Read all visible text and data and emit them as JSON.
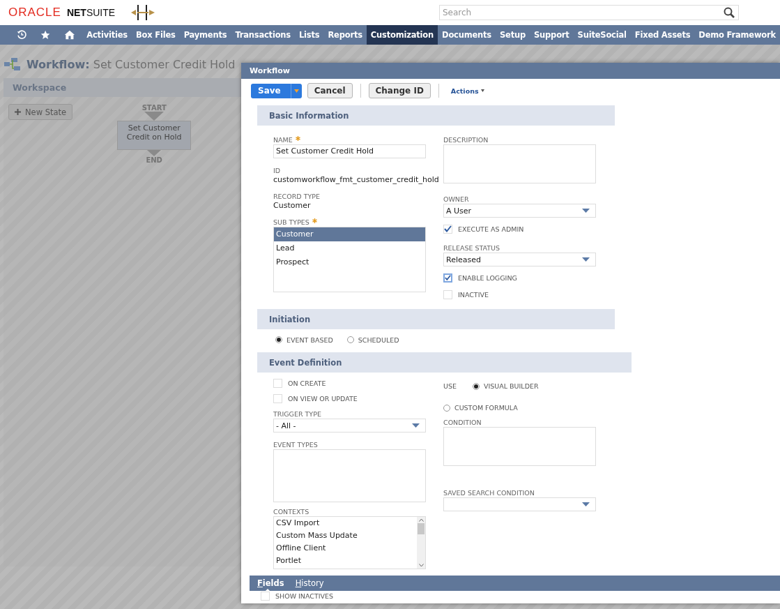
{
  "brand": {
    "oracle": "ORACLE",
    "netsuite": "**NET**SUITE"
  },
  "search": {
    "placeholder": "Search"
  },
  "nav": [
    {
      "label": "Activities",
      "selected": false
    },
    {
      "label": "Box Files",
      "selected": false
    },
    {
      "label": "Payments",
      "selected": false
    },
    {
      "label": "Transactions",
      "selected": false
    },
    {
      "label": "Lists",
      "selected": false
    },
    {
      "label": "Reports",
      "selected": false
    },
    {
      "label": "Customization",
      "selected": true
    },
    {
      "label": "Documents",
      "selected": false
    },
    {
      "label": "Setup",
      "selected": false
    },
    {
      "label": "Support",
      "selected": false
    },
    {
      "label": "SuiteSocial",
      "selected": false
    },
    {
      "label": "Fixed Assets",
      "selected": false
    },
    {
      "label": "Demo Framework",
      "selected": false
    }
  ],
  "page_title": {
    "label": "Workflow:",
    "value": "Set Customer Credit Hold"
  },
  "workspace": {
    "title": "Workspace",
    "new_state": "New State",
    "start": "START",
    "state": "Set Customer Credit on Hold",
    "end": "END"
  },
  "dialog": {
    "title": "Workflow",
    "save": "Save",
    "cancel": "Cancel",
    "change_id": "Change ID",
    "actions": "Actions"
  },
  "basic_information": {
    "title": "Basic Information",
    "name": {
      "label": "NAME",
      "required": true,
      "value": "Set Customer Credit Hold"
    },
    "id": {
      "label": "ID",
      "value": "customworkflow_fmt_customer_credit_hold"
    },
    "record_type": {
      "label": "RECORD TYPE",
      "value": "Customer"
    },
    "sub_types": {
      "label": "SUB TYPES",
      "required": true,
      "options": [
        {
          "label": "Customer",
          "selected": true
        },
        {
          "label": "Lead",
          "selected": false
        },
        {
          "label": "Prospect",
          "selected": false
        }
      ]
    },
    "description": {
      "label": "DESCRIPTION"
    },
    "owner": {
      "label": "OWNER",
      "value": "A User"
    },
    "execute_as_admin": {
      "label": "EXECUTE AS ADMIN",
      "checked": true
    },
    "release_status": {
      "label": "RELEASE STATUS",
      "value": "Released"
    },
    "enable_logging": {
      "label": "ENABLE LOGGING",
      "checked": true,
      "focused": true
    },
    "inactive": {
      "label": "INACTIVE",
      "checked": false
    }
  },
  "initiation": {
    "title": "Initiation",
    "options": [
      {
        "label": "EVENT BASED",
        "selected": true
      },
      {
        "label": "SCHEDULED",
        "selected": false
      }
    ]
  },
  "event_definition": {
    "title": "Event Definition",
    "on_create": {
      "label": "ON CREATE",
      "checked": false
    },
    "on_view_or_update": {
      "label": "ON VIEW OR UPDATE",
      "checked": false
    },
    "trigger_type": {
      "label": "TRIGGER TYPE",
      "value": "- All -"
    },
    "event_types": {
      "label": "EVENT TYPES"
    },
    "contexts": {
      "label": "CONTEXTS",
      "options": [
        {
          "label": "CSV Import",
          "selected": false
        },
        {
          "label": "Custom Mass Update",
          "selected": false
        },
        {
          "label": "Offline Client",
          "selected": false
        },
        {
          "label": "Portlet",
          "selected": false
        }
      ]
    },
    "use": {
      "label": "USE",
      "options": [
        {
          "label": "VISUAL BUILDER",
          "selected": true
        },
        {
          "label": "CUSTOM FORMULA",
          "selected": false
        }
      ]
    },
    "condition": {
      "label": "CONDITION"
    },
    "saved_search_condition": {
      "label": "SAVED SEARCH CONDITION"
    }
  },
  "tabs": [
    {
      "label": "Fields",
      "selected": true
    },
    {
      "label": "History",
      "selected": false
    }
  ],
  "show_inactives": {
    "label": "SHOW INACTIVES",
    "checked": false
  }
}
